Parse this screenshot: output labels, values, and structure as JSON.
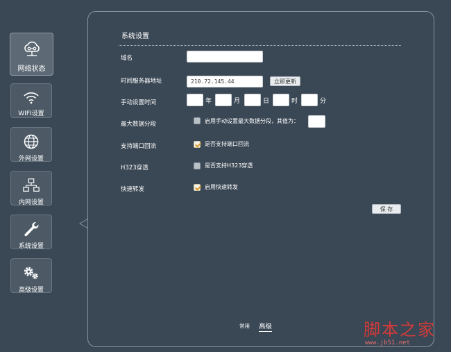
{
  "sidebar": {
    "items": [
      {
        "label": "网络状态",
        "icon": "cloud-network-icon",
        "active": true
      },
      {
        "label": "WIFI设置",
        "icon": "wifi-icon",
        "active": false
      },
      {
        "label": "外网设置",
        "icon": "globe-icon",
        "active": false
      },
      {
        "label": "内网设置",
        "icon": "lan-topology-icon",
        "active": false
      },
      {
        "label": "系统设置",
        "icon": "wrench-icon",
        "active": false
      },
      {
        "label": "高级设置",
        "icon": "gears-icon",
        "active": false
      }
    ]
  },
  "panel": {
    "title": "系统设置",
    "domain": {
      "label": "域名",
      "value": ""
    },
    "time_server": {
      "label": "时间服务器地址",
      "value": "210.72.145.44",
      "update_button": "立即更新"
    },
    "manual_time": {
      "label": "手动设置时间",
      "units": [
        "年",
        "月",
        "日",
        "时",
        "分"
      ]
    },
    "max_segment": {
      "label": "最大数据分段",
      "checkbox_label": "启用手动设置最大数据分段，其值为：",
      "checked": false,
      "value": ""
    },
    "port_loopback": {
      "label": "支持端口回流",
      "checkbox_label": "是否支持端口回流",
      "checked": true
    },
    "h323": {
      "label": "H323穿透",
      "checkbox_label": "是否支持H323穿透",
      "checked": false
    },
    "fast_forward": {
      "label": "快速转发",
      "checkbox_label": "启用快速转发",
      "checked": true
    },
    "save_button": "保 存"
  },
  "bottom_tabs": {
    "common": "常用",
    "advanced": "高级"
  },
  "watermark": {
    "text": "脚本之家",
    "url": "www.jb51.net"
  },
  "colors": {
    "background": "#3a4754",
    "tile": "#4d5a66",
    "check_accent": "#d89a2c",
    "watermark": "#d33a3a"
  }
}
